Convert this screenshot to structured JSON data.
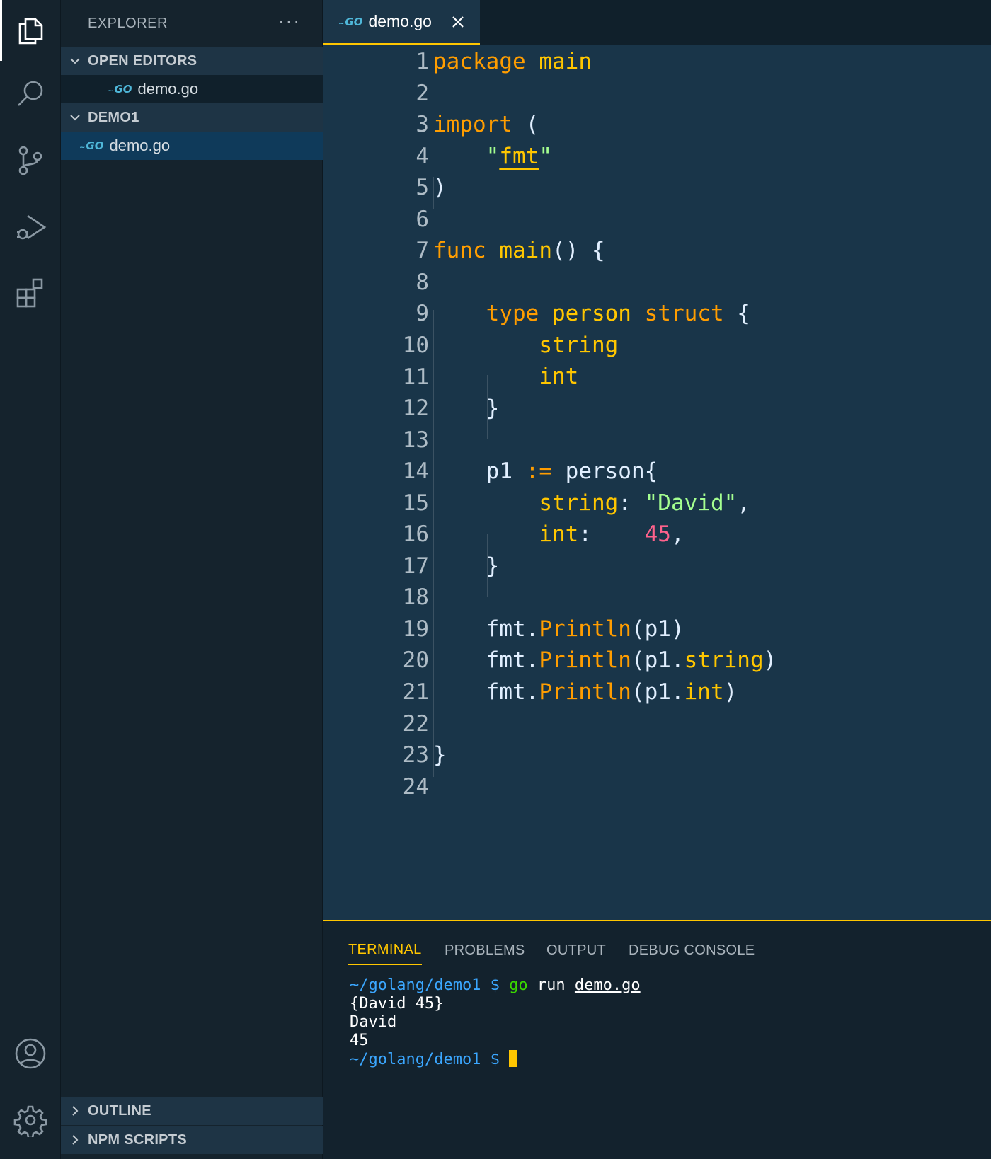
{
  "sidebar": {
    "title": "EXPLORER",
    "more": "···",
    "open_editors": {
      "label": "OPEN EDITORS",
      "file": "demo.go"
    },
    "folder": {
      "label": "DEMO1",
      "file": "demo.go"
    },
    "outline_label": "OUTLINE",
    "npm_label": "NPM SCRIPTS",
    "go_badge": "GO"
  },
  "tab": {
    "label": "demo.go",
    "badge": "GO"
  },
  "editor": {
    "line_numbers": [
      "1",
      "2",
      "3",
      "4",
      "5",
      "6",
      "7",
      "8",
      "9",
      "10",
      "11",
      "12",
      "13",
      "14",
      "15",
      "16",
      "17",
      "18",
      "19",
      "20",
      "21",
      "22",
      "23",
      "24"
    ],
    "code": {
      "l1_kw": "package",
      "l1_name": "main",
      "l3_kw": "import",
      "l3_paren": "(",
      "l4_q1": "\"",
      "l4_pkg": "fmt",
      "l4_q2": "\"",
      "l5": ")",
      "l7_kw": "func",
      "l7_name": "main",
      "l7_rest": "() {",
      "l9_kw": "type",
      "l9_name": "person",
      "l9_kw2": "struct",
      "l9_brace": "{",
      "l10": "string",
      "l11": "int",
      "l12": "}",
      "l14_var": "p1",
      "l14_op": ":=",
      "l14_rest": "person{",
      "l15_field": "string",
      "l15_colon": ":",
      "l15_val": "\"David\"",
      "l15_comma": ",",
      "l16_field": "int",
      "l16_colon": ":",
      "l16_val": "45",
      "l16_comma": ",",
      "l17": "}",
      "l19_pkg": "fmt.",
      "l19_fn": "Println",
      "l19_args": "(p1)",
      "l20_pkg": "fmt.",
      "l20_fn": "Println",
      "l20_a1": "(p1.",
      "l20_a2": "string",
      "l20_a3": ")",
      "l21_pkg": "fmt.",
      "l21_fn": "Println",
      "l21_a1": "(p1.",
      "l21_a2": "int",
      "l21_a3": ")",
      "l23": "}"
    }
  },
  "panel": {
    "tabs": [
      "TERMINAL",
      "PROBLEMS",
      "OUTPUT",
      "DEBUG CONSOLE"
    ],
    "terminal": {
      "prompt_path": "~/golang/demo1 $",
      "cmd_go": "go",
      "cmd_run": "run",
      "cmd_file": "demo.go",
      "out1": "{David 45}",
      "out2": "David",
      "out3": "45",
      "prompt2_path": "~/golang/demo1 $"
    }
  },
  "colors": {
    "accent": "#ffc600",
    "keyword": "#ff9d00",
    "string": "#a5ff90",
    "number": "#ff628c",
    "editor_bg": "#193549",
    "sidebar_bg": "#15232d",
    "terminal_path": "#3ba7ff"
  },
  "icons": {
    "activity": [
      "files-icon",
      "search-icon",
      "source-control-icon",
      "run-debug-icon",
      "extensions-icon",
      "account-icon",
      "settings-gear-icon"
    ]
  }
}
